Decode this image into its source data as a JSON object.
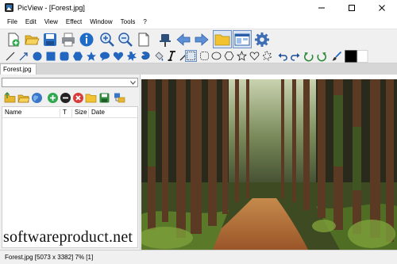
{
  "window": {
    "title": "PicView - [Forest.jpg]",
    "controls": {
      "minimize_icon": "minimize-icon",
      "maximize_icon": "maximize-icon",
      "close_icon": "close-icon"
    }
  },
  "menu": {
    "items": [
      "File",
      "Edit",
      "View",
      "Effect",
      "Window",
      "Tools",
      "?"
    ]
  },
  "toolbar": {
    "row1_icons": [
      "new-icon",
      "open-folder-icon",
      "save-icon",
      "print-icon",
      "info-icon",
      "zoom-in-icon",
      "zoom-out-icon",
      "page-icon",
      "pin-icon",
      "arrow-left-icon",
      "arrow-right-icon",
      "folder-view-icon",
      "window-layout-icon",
      "settings-icon"
    ],
    "row2_icons": [
      "pencil-icon",
      "line-icon",
      "arrow-tool-icon",
      "ellipse-fill-icon",
      "rect-fill-icon",
      "rounded-rect-fill-icon",
      "hexagon-fill-icon",
      "star-fill-icon",
      "speech-bubble-icon",
      "heart-fill-icon",
      "burst-icon",
      "lasso-icon",
      "fill-bucket-icon",
      "text-tool-icon",
      "color-picker-icon",
      "select-rect-icon",
      "select-rounded-icon",
      "select-ellipse-icon",
      "select-hexagon-icon",
      "select-star-icon",
      "select-heart-icon",
      "select-burst-icon",
      "undo-icon",
      "redo-icon",
      "rotate-left-icon",
      "rotate-right-icon",
      "brush-icon",
      "color-swatch-icon"
    ],
    "foreground_color": "#000000",
    "background_color": "#ffffff"
  },
  "tabs": [
    {
      "label": "Forest.jpg"
    }
  ],
  "browser": {
    "path_value": "",
    "toolbar_icons": [
      "folder-up-icon",
      "folder-open-icon",
      "globe-icon",
      "add-icon",
      "remove-icon",
      "delete-icon",
      "folder-icon",
      "save-list-icon",
      "folder-tree-icon"
    ],
    "columns": [
      "Name",
      "T",
      "Size",
      "Date"
    ],
    "rows": []
  },
  "watermark": "softwareproduct.net",
  "status": {
    "text": "Forest.jpg [5073 x 3382] 7% [1]"
  }
}
